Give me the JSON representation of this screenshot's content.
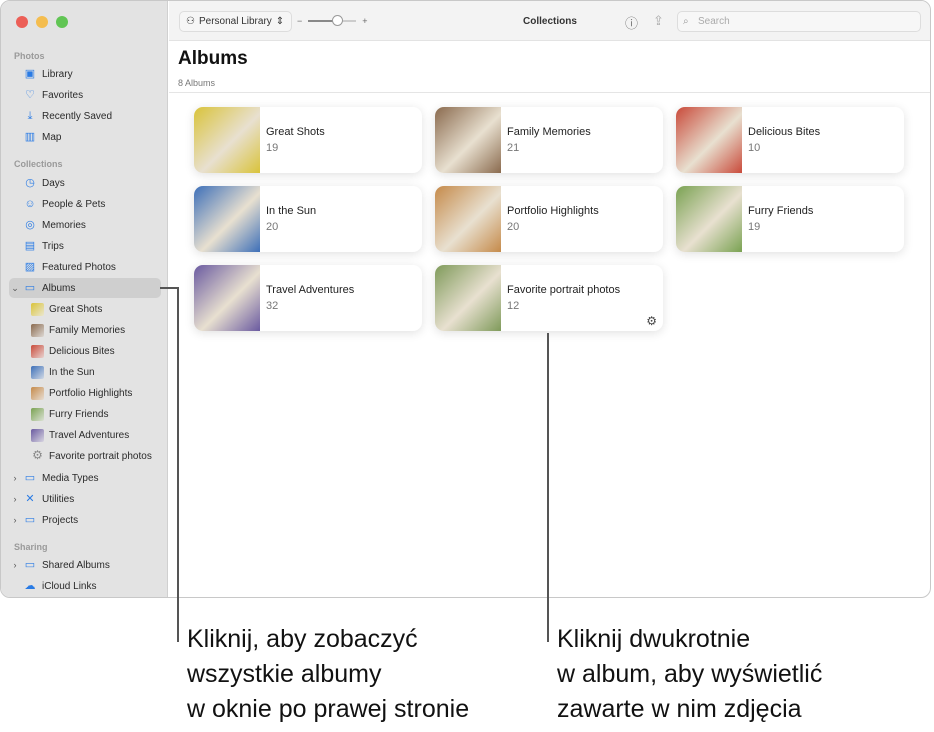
{
  "toolbar": {
    "library": "Personal Library",
    "zoom_minus": "−",
    "zoom_plus": "+",
    "zoom_level": 0.6,
    "title": "Collections",
    "search_placeholder": "Search"
  },
  "sidebar": {
    "photos_header": "Photos",
    "library": "Library",
    "favorites": "Favorites",
    "recently_saved": "Recently Saved",
    "map": "Map",
    "collections_header": "Collections",
    "days": "Days",
    "people_pets": "People & Pets",
    "memories": "Memories",
    "trips": "Trips",
    "featured": "Featured Photos",
    "albums": "Albums",
    "album_items": [
      "Great Shots",
      "Family Memories",
      "Delicious Bites",
      "In the Sun",
      "Portfolio Highlights",
      "Furry Friends",
      "Travel Adventures",
      "Favorite portrait photos"
    ],
    "media_types": "Media Types",
    "utilities": "Utilities",
    "projects": "Projects",
    "sharing_header": "Sharing",
    "shared_albums": "Shared Albums",
    "icloud_links": "iCloud Links"
  },
  "main": {
    "title": "Albums",
    "count": "8 Albums",
    "albums": [
      {
        "name": "Great Shots",
        "count": "19",
        "color": "#d9c33a"
      },
      {
        "name": "Family Memories",
        "count": "21",
        "color": "#8a6a4e"
      },
      {
        "name": "Delicious Bites",
        "count": "10",
        "color": "#c94a3a"
      },
      {
        "name": "In the Sun",
        "count": "20",
        "color": "#3d6fb8"
      },
      {
        "name": "Portfolio Highlights",
        "count": "20",
        "color": "#c58a4a"
      },
      {
        "name": "Furry Friends",
        "count": "19",
        "color": "#7aa252"
      },
      {
        "name": "Travel Adventures",
        "count": "32",
        "color": "#6a5aa0"
      },
      {
        "name": "Favorite portrait photos",
        "count": "12",
        "color": "#7f9a5a"
      }
    ]
  },
  "callouts": {
    "left": [
      "Kliknij, aby zobaczyć",
      "wszystkie albumy",
      "w oknie po prawej stronie"
    ],
    "right": [
      "Kliknij dwukrotnie",
      "w album, aby wyświetlić",
      "zawarte w nim zdjęcia"
    ]
  }
}
